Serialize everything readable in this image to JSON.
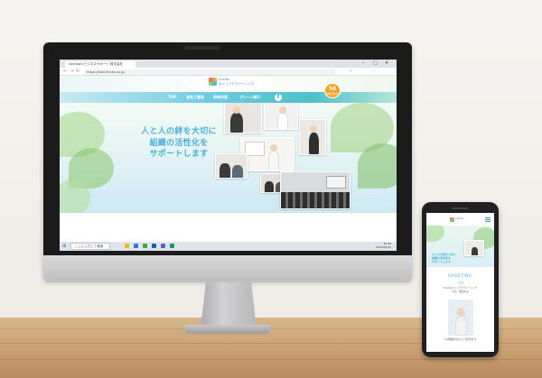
{
  "browser": {
    "tab_title": "shunashi ビジネスサポート 株式会社",
    "url": "https://sabi-thinka.co.jp/",
    "window_controls": [
      "–",
      "□",
      "✕"
    ]
  },
  "site": {
    "logo_text_line1": "f-kards",
    "logo_text_line2": "キャリアグラシーシング",
    "nav": [
      "TOP",
      "会社と理念",
      "研修内容",
      "プレーン紹介"
    ],
    "facebook_glyph": "f",
    "badge_number": "50",
    "badge_text": "無料相談受付中",
    "hero_copy": [
      "人と人の絆を大切に",
      "組織の活性化を",
      "サポートします"
    ]
  },
  "taskbar": {
    "search_placeholder": "ここに入力して検索",
    "clock_time": "10:44",
    "clock_date": "2021/05/21"
  },
  "phone": {
    "hero_copy": [
      "人と人の絆を大切に",
      "組織の活性化を",
      "サポートします"
    ],
    "greeting_title": "GREETING",
    "greeting_sub": "ご挨拶",
    "greeting_text": [
      "f-kardsキャリアグラシーシング",
      "代表　藤田ゆみ"
    ],
    "footer_text": "人が組織を生かして活性化する"
  },
  "colors": {
    "accent": "#4bb1d8",
    "badge": "#f3a021",
    "nav_gradient": "#6ccbe0"
  }
}
